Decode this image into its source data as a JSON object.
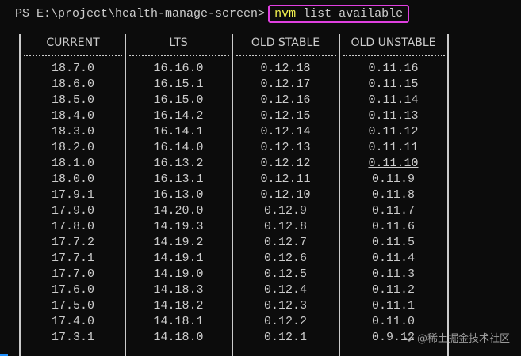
{
  "terminal": {
    "prompt": "PS E:\\project\\health-manage-screen>",
    "command_name": "nvm",
    "command_args": " list available",
    "highlight_color": "#e040e0"
  },
  "table": {
    "headers": [
      "CURRENT",
      "LTS",
      "OLD STABLE",
      "OLD UNSTABLE"
    ],
    "rows": [
      [
        "18.7.0",
        "16.16.0",
        "0.12.18",
        "0.11.16"
      ],
      [
        "18.6.0",
        "16.15.1",
        "0.12.17",
        "0.11.15"
      ],
      [
        "18.5.0",
        "16.15.0",
        "0.12.16",
        "0.11.14"
      ],
      [
        "18.4.0",
        "16.14.2",
        "0.12.15",
        "0.11.13"
      ],
      [
        "18.3.0",
        "16.14.1",
        "0.12.14",
        "0.11.12"
      ],
      [
        "18.2.0",
        "16.14.0",
        "0.12.13",
        "0.11.11"
      ],
      [
        "18.1.0",
        "16.13.2",
        "0.12.12",
        "0.11.10"
      ],
      [
        "18.0.0",
        "16.13.1",
        "0.12.11",
        "0.11.9"
      ],
      [
        "17.9.1",
        "16.13.0",
        "0.12.10",
        "0.11.8"
      ],
      [
        "17.9.0",
        "14.20.0",
        "0.12.9",
        "0.11.7"
      ],
      [
        "17.8.0",
        "14.19.3",
        "0.12.8",
        "0.11.6"
      ],
      [
        "17.7.2",
        "14.19.2",
        "0.12.7",
        "0.11.5"
      ],
      [
        "17.7.1",
        "14.19.1",
        "0.12.6",
        "0.11.4"
      ],
      [
        "17.7.0",
        "14.19.0",
        "0.12.5",
        "0.11.3"
      ],
      [
        "17.6.0",
        "14.18.3",
        "0.12.4",
        "0.11.2"
      ],
      [
        "17.5.0",
        "14.18.2",
        "0.12.3",
        "0.11.1"
      ],
      [
        "17.4.0",
        "14.18.1",
        "0.12.2",
        "0.11.0"
      ],
      [
        "17.3.1",
        "14.18.0",
        "0.12.1",
        "0.9.12"
      ]
    ]
  },
  "watermark": {
    "text": "@稀土掘金技术社区"
  }
}
